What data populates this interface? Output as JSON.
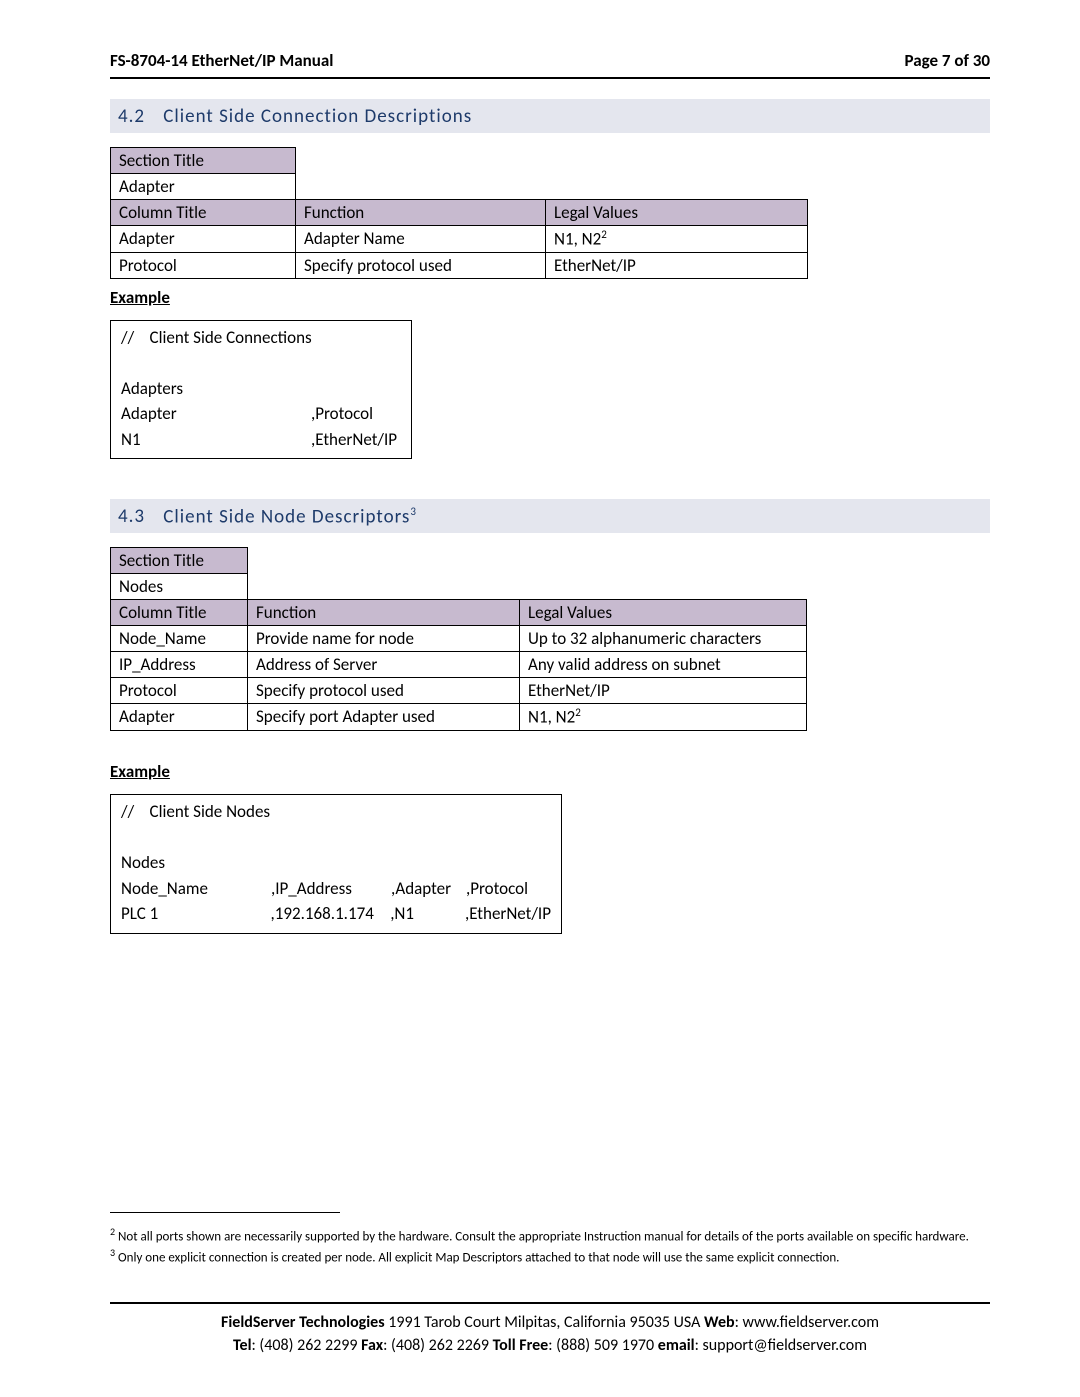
{
  "header": {
    "title": "FS-8704-14 EtherNet/IP Manual",
    "page_label": "Page 7 of 30"
  },
  "section42": {
    "num": "4.2",
    "title": "Client Side Connection Descriptions",
    "table": {
      "section_title_label": "Section Title",
      "section_title_value": "Adapter",
      "col_label": "Column Title",
      "func_label": "Function",
      "legal_label": "Legal Values",
      "rows": [
        {
          "c": "Adapter",
          "f": "Adapter Name",
          "l": "N1, N2",
          "sup": "2"
        },
        {
          "c": "Protocol",
          "f": "Specify protocol used",
          "l": "EtherNet/IP",
          "sup": ""
        }
      ]
    },
    "example_label": "Example",
    "example": {
      "l1": "//    Client Side Connections",
      "l2": "Adapters",
      "l3a": "Adapter",
      "l3b": ",Protocol",
      "l4a": "N1",
      "l4b": ",EtherNet/IP"
    }
  },
  "section43": {
    "num": "4.3",
    "title": "Client Side Node Descriptors",
    "sup": "3",
    "table": {
      "section_title_label": "Section Title",
      "section_title_value": "Nodes",
      "col_label": "Column Title",
      "func_label": "Function",
      "legal_label": "Legal Values",
      "rows": [
        {
          "c": "Node_Name",
          "f": "Provide name for node",
          "l": "Up to 32 alphanumeric characters",
          "sup": ""
        },
        {
          "c": "IP_Address",
          "f": "Address of Server",
          "l": "Any valid address on subnet",
          "sup": ""
        },
        {
          "c": "Protocol",
          "f": "Specify protocol used",
          "l": "EtherNet/IP",
          "sup": ""
        },
        {
          "c": "Adapter",
          "f": "Specify port Adapter used",
          "l": "N1, N2",
          "sup": "2"
        }
      ]
    },
    "example_label": "Example",
    "example": {
      "l1": "//    Client Side Nodes",
      "l2": "Nodes",
      "h1": "Node_Name",
      "h2": ",IP_Address",
      "h3": ",Adapter",
      "h4": ",Protocol",
      "d1": "PLC 1",
      "d2": ",192.168.1.174",
      "d3": ",N1",
      "d4": ",EtherNet/IP"
    }
  },
  "footnotes": {
    "n2_sup": "2",
    "n2": " Not all ports shown are necessarily supported by the hardware. Consult the appropriate Instruction manual for details of the ports available on specific hardware.",
    "n3_sup": "3",
    "n3": " Only one explicit connection is created per node.  All explicit Map Descriptors attached to that node will use the same explicit connection."
  },
  "footer": {
    "company": "FieldServer Technologies",
    "addr": " 1991 Tarob Court Milpitas, California 95035 USA   ",
    "web_l": "Web",
    "web_v": ": www.fieldserver.com",
    "tel_l": "Tel",
    "tel_v": ": (408) 262 2299   ",
    "fax_l": "Fax",
    "fax_v": ": (408) 262 2269   ",
    "tf_l": "Toll Free",
    "tf_v": ": (888) 509 1970   ",
    "em_l": "email",
    "em_v": ": support@fieldserver.com"
  }
}
